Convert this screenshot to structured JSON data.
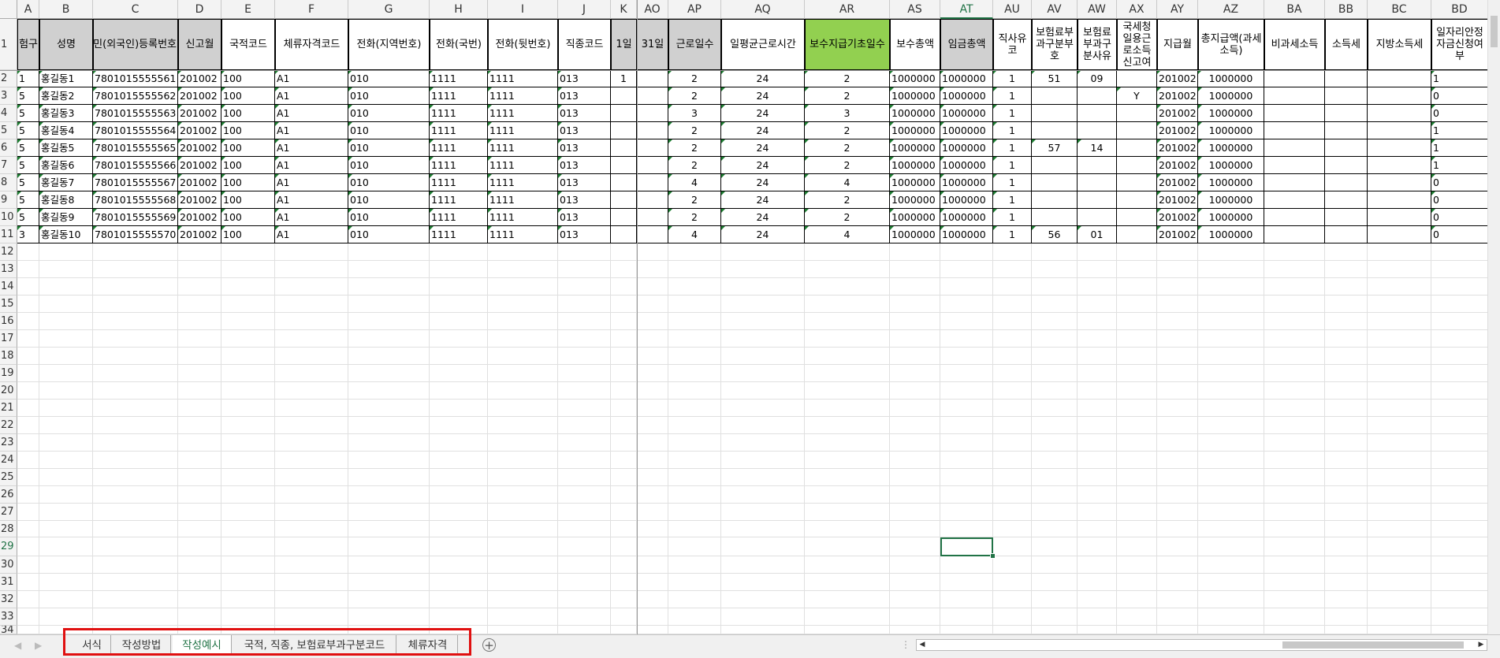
{
  "column_letters": [
    "A",
    "B",
    "C",
    "D",
    "E",
    "F",
    "G",
    "H",
    "I",
    "J",
    "K",
    "AO",
    "AP",
    "AQ",
    "AR",
    "AS",
    "AT",
    "AU",
    "AV",
    "AW",
    "AX",
    "AY",
    "AZ",
    "BA",
    "BB",
    "BC",
    "BD"
  ],
  "row_numbers": [
    "1",
    "2",
    "3",
    "4",
    "5",
    "6",
    "7",
    "8",
    "9",
    "10",
    "11",
    "12",
    "13",
    "14",
    "15",
    "16",
    "17",
    "18",
    "19",
    "20",
    "21",
    "22",
    "23",
    "24",
    "25",
    "26",
    "27",
    "28",
    "29",
    "30",
    "31",
    "32",
    "33",
    "34"
  ],
  "headers": [
    "험구",
    "성명",
    "주민(외국인)등록번호",
    "신고월",
    "국적코드",
    "체류자격코드",
    "전화(지역번호)",
    "전화(국번)",
    "전화(뒷번호)",
    "직종코드",
    "1일",
    "31일",
    "근로일수",
    "일평균근로시간",
    "보수지급기초일수",
    "보수총액",
    "임금총액",
    "직사유코",
    "보험료부과구분부호",
    "보험료부과구분사유",
    "국세청일용근로소득신고여",
    "지급월",
    "총지급액(과세소득)",
    "비과세소득",
    "소득세",
    "지방소득세",
    "일자리안정자금신청여부"
  ],
  "rows": [
    [
      "1",
      "홍길동1",
      "7801015555561",
      "201002",
      "100",
      "A1",
      "010",
      "1111",
      "1111",
      "013",
      "1",
      "",
      "2",
      "24",
      "2",
      "1000000",
      "1000000",
      "1",
      "51",
      "09",
      "",
      "201002",
      "1000000",
      "",
      "",
      "",
      "1"
    ],
    [
      "5",
      "홍길동2",
      "7801015555562",
      "201002",
      "100",
      "A1",
      "010",
      "1111",
      "1111",
      "013",
      "",
      "",
      "2",
      "24",
      "2",
      "1000000",
      "1000000",
      "1",
      "",
      "",
      "Y",
      "201002",
      "1000000",
      "",
      "",
      "",
      "0"
    ],
    [
      "5",
      "홍길동3",
      "7801015555563",
      "201002",
      "100",
      "A1",
      "010",
      "1111",
      "1111",
      "013",
      "",
      "",
      "3",
      "24",
      "3",
      "1000000",
      "1000000",
      "1",
      "",
      "",
      "",
      "201002",
      "1000000",
      "",
      "",
      "",
      "0"
    ],
    [
      "5",
      "홍길동4",
      "7801015555564",
      "201002",
      "100",
      "A1",
      "010",
      "1111",
      "1111",
      "013",
      "",
      "",
      "2",
      "24",
      "2",
      "1000000",
      "1000000",
      "1",
      "",
      "",
      "",
      "201002",
      "1000000",
      "",
      "",
      "",
      "1"
    ],
    [
      "5",
      "홍길동5",
      "7801015555565",
      "201002",
      "100",
      "A1",
      "010",
      "1111",
      "1111",
      "013",
      "",
      "",
      "2",
      "24",
      "2",
      "1000000",
      "1000000",
      "1",
      "57",
      "14",
      "",
      "201002",
      "1000000",
      "",
      "",
      "",
      "1"
    ],
    [
      "5",
      "홍길동6",
      "7801015555566",
      "201002",
      "100",
      "A1",
      "010",
      "1111",
      "1111",
      "013",
      "",
      "",
      "2",
      "24",
      "2",
      "1000000",
      "1000000",
      "1",
      "",
      "",
      "",
      "201002",
      "1000000",
      "",
      "",
      "",
      "1"
    ],
    [
      "5",
      "홍길동7",
      "7801015555567",
      "201002",
      "100",
      "A1",
      "010",
      "1111",
      "1111",
      "013",
      "",
      "",
      "4",
      "24",
      "4",
      "1000000",
      "1000000",
      "1",
      "",
      "",
      "",
      "201002",
      "1000000",
      "",
      "",
      "",
      "0"
    ],
    [
      "5",
      "홍길동8",
      "7801015555568",
      "201002",
      "100",
      "A1",
      "010",
      "1111",
      "1111",
      "013",
      "",
      "",
      "2",
      "24",
      "2",
      "1000000",
      "1000000",
      "1",
      "",
      "",
      "",
      "201002",
      "1000000",
      "",
      "",
      "",
      "0"
    ],
    [
      "5",
      "홍길동9",
      "7801015555569",
      "201002",
      "100",
      "A1",
      "010",
      "1111",
      "1111",
      "013",
      "",
      "",
      "2",
      "24",
      "2",
      "1000000",
      "1000000",
      "1",
      "",
      "",
      "",
      "201002",
      "1000000",
      "",
      "",
      "",
      "0"
    ],
    [
      "3",
      "홍길동10",
      "7801015555570",
      "201002",
      "100",
      "A1",
      "010",
      "1111",
      "1111",
      "013",
      "",
      "",
      "4",
      "24",
      "4",
      "1000000",
      "1000000",
      "1",
      "56",
      "01",
      "",
      "201002",
      "1000000",
      "",
      "",
      "",
      "0"
    ]
  ],
  "sheet_tabs": [
    "서식",
    "작성방법",
    "작성예시",
    "국적, 직종, 보험료부과구분코드",
    "체류자격"
  ],
  "active_tab": "작성예시",
  "active_column": "AT",
  "active_row": "29",
  "colors": {
    "header_gray": "#d0d0d0",
    "header_green": "#92d050",
    "excel_green": "#217346",
    "highlight_red": "#e01010"
  },
  "icons": {
    "add_sheet": "plus-circle-icon",
    "nav_prev": "triangle-left-icon",
    "nav_next": "triangle-right-icon"
  }
}
